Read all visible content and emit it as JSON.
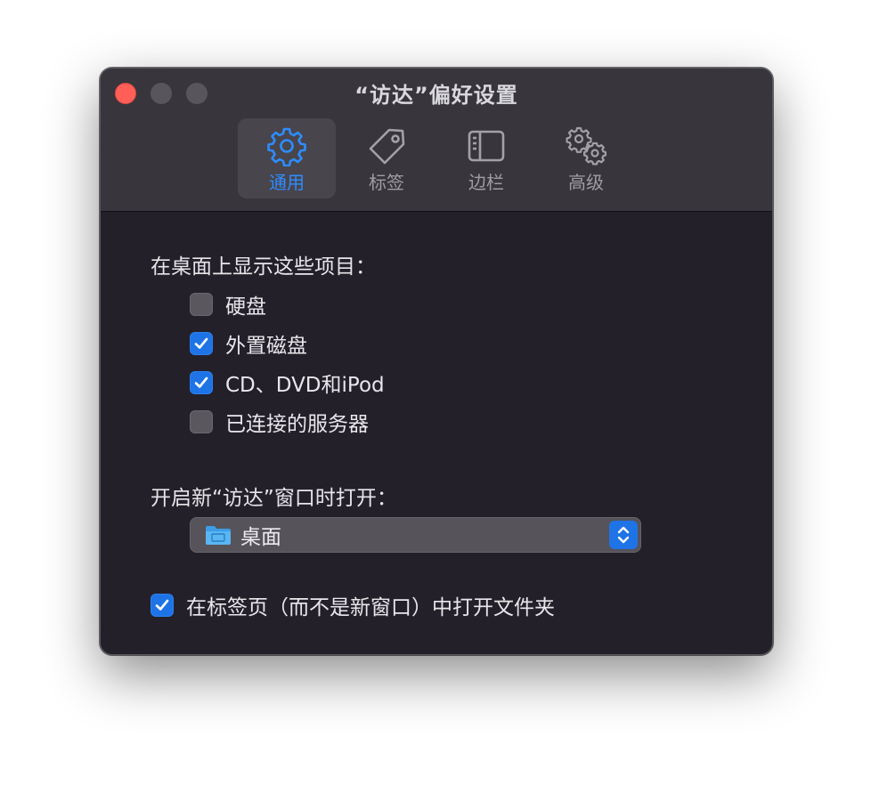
{
  "window": {
    "title": "“访达”偏好设置"
  },
  "toolbar": {
    "tabs": [
      {
        "label": "通用",
        "icon": "gear-icon",
        "active": true
      },
      {
        "label": "标签",
        "icon": "tag-icon",
        "active": false
      },
      {
        "label": "边栏",
        "icon": "sidebar-icon",
        "active": false
      },
      {
        "label": "高级",
        "icon": "gears-icon",
        "active": false
      }
    ]
  },
  "desktop_items": {
    "heading": "在桌面上显示这些项目：",
    "options": [
      {
        "label": "硬盘",
        "checked": false
      },
      {
        "label": "外置磁盘",
        "checked": true
      },
      {
        "label": "CD、DVD和iPod",
        "checked": true
      },
      {
        "label": "已连接的服务器",
        "checked": false
      }
    ]
  },
  "new_window": {
    "heading": "开启新“访达”窗口时打开：",
    "selected": "桌面"
  },
  "tabs_option": {
    "label": "在标签页（而不是新窗口）中打开文件夹",
    "checked": true
  },
  "colors": {
    "accent": "#1e74e6",
    "active_label": "#2e8cff",
    "close_button": "#ff5f57",
    "window_bg": "#24202a",
    "titlebar_bg": "#38353c"
  }
}
